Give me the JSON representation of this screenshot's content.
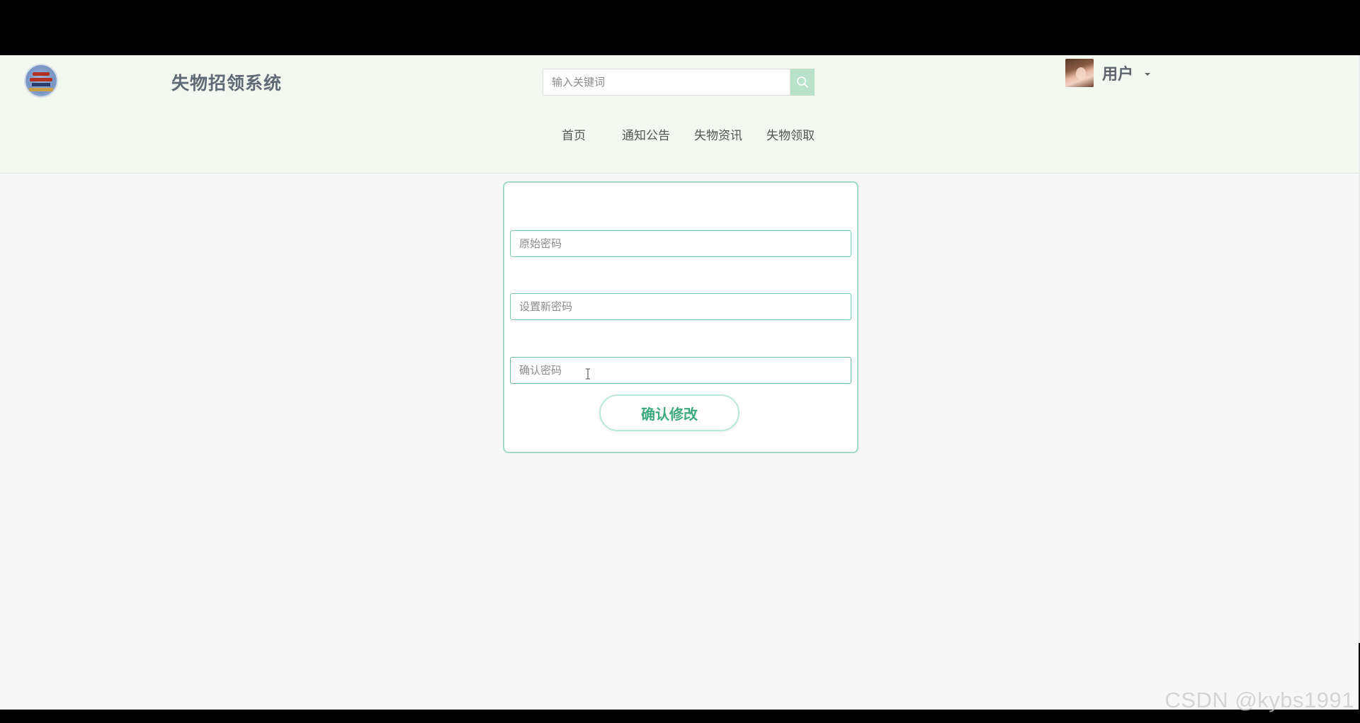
{
  "header": {
    "site_title": "失物招领系统",
    "search": {
      "placeholder": "输入关键词",
      "value": ""
    },
    "user": {
      "name": "用户"
    }
  },
  "nav": {
    "items": [
      {
        "label": "首页"
      },
      {
        "label": "通知公告"
      },
      {
        "label": "失物资讯"
      },
      {
        "label": "失物领取"
      }
    ]
  },
  "password_form": {
    "old_password_placeholder": "原始密码",
    "new_password_placeholder": "设置新密码",
    "confirm_password_placeholder": "确认密码",
    "submit_label": "确认修改"
  },
  "watermark": "CSDN @kybs1991",
  "colors": {
    "header_bg": "#f3f8f1",
    "accent_green": "#3fa980",
    "card_border": "#9fdcc3",
    "search_button": "#b8e3ca"
  }
}
